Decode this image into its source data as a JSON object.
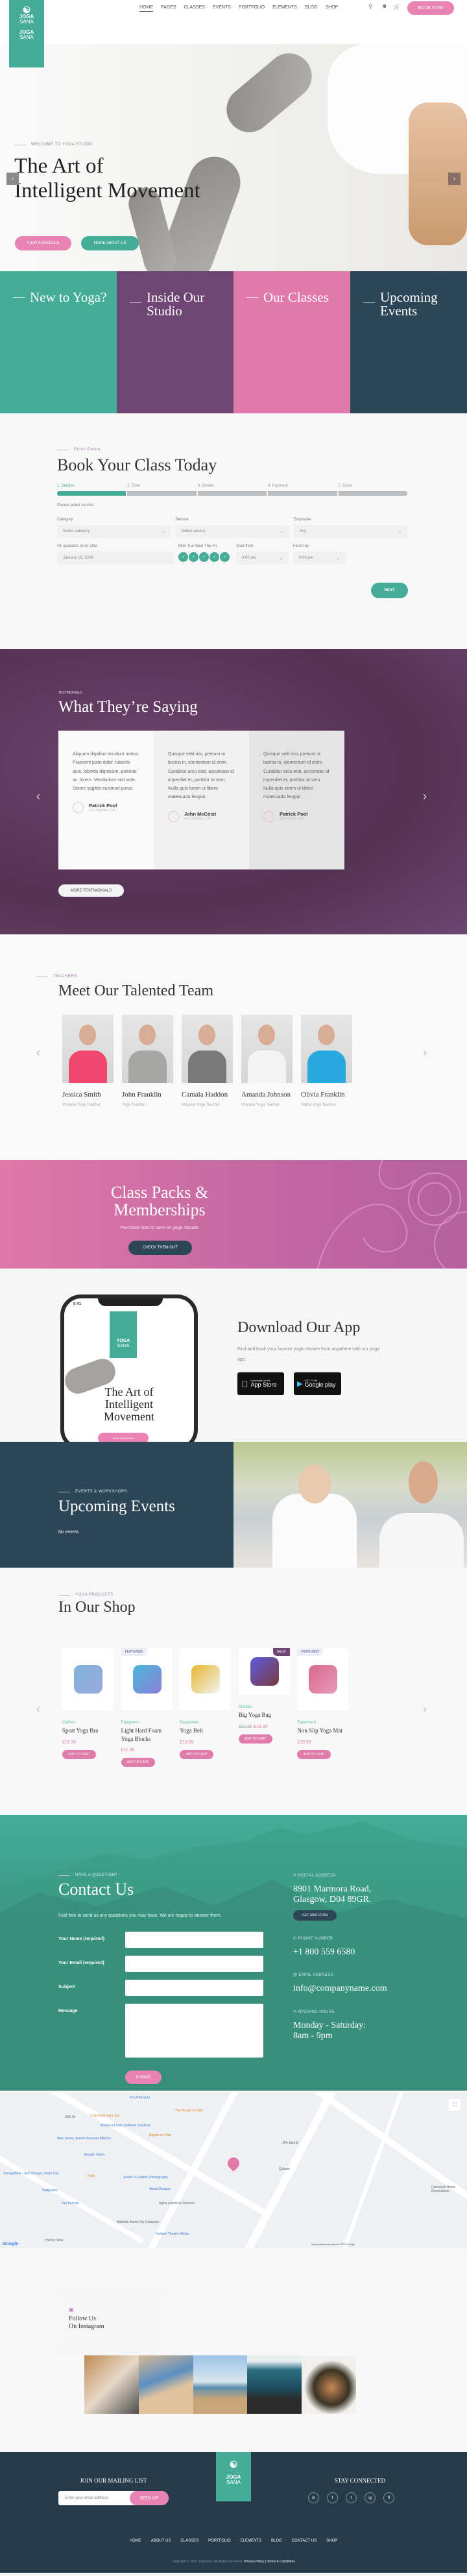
{
  "header": {
    "logo": {
      "line1": "JOGA",
      "line2": "SANA",
      "line3": "JOGA",
      "line4": "SANA"
    },
    "nav": [
      "HOME",
      "PAGES",
      "CLASSES",
      "EVENTS",
      "PORTFOLIO",
      "ELEMENTS",
      "BLOG",
      "SHOP"
    ],
    "active_nav": "HOME",
    "book_now": "BOOK NOW"
  },
  "hero": {
    "eyebrow": "WELCOME TO YOGA STUDIO",
    "title_line1": "The Art of",
    "title_line2": "Intelligent Movement",
    "btn_schedule": "VIEW SCHEDULE",
    "btn_about": "MORE ABOUT US"
  },
  "feature_boxes": [
    {
      "title": "New to Yoga?",
      "color": "#45ad97"
    },
    {
      "title": "Inside Our Studio",
      "color": "#6f4573"
    },
    {
      "title": "Our Classes",
      "color": "#e07aab"
    },
    {
      "title": "Upcoming Events",
      "color": "#2d4657"
    }
  ],
  "booking": {
    "eyebrow": "Enroll Online",
    "title": "Book Your Class Today",
    "steps": [
      "1. Service",
      "2. Time",
      "3. Details",
      "4. Payment",
      "5. Done"
    ],
    "active_step": 1,
    "prompt": "Please select service:",
    "category_label": "Category",
    "category_value": "Select category",
    "service_label": "Service",
    "service_value": "Select service",
    "employee_label": "Employee",
    "employee_value": "Any",
    "date_label": "I'm available on or after",
    "date_value": "January 19, 2024",
    "days": [
      "Mon",
      "Tue",
      "Wed",
      "Thu",
      "Fri"
    ],
    "start_label": "Start from",
    "start_value": "8:00 am",
    "finish_label": "Finish by",
    "finish_value": "6:00 pm",
    "next": "NEXT"
  },
  "testimonials": {
    "eyebrow": "TESTIMONIALS",
    "title": "What They’re Saying",
    "items": [
      {
        "text": "Aliquam dapibus tincidunt metus. Praesent justo dolor, lobortis quis, lobortis dignissim, pulvinar ac, lorem. Vestibulum sed ante. Donec sagittis euismod purus.",
        "name": "Patrick Pool",
        "place": "Los Angeles, CA"
      },
      {
        "text": "Quisque velit nisi, pretium ut lacinia in, elementum id enim. Curabitur arcu erat, accumsan id imperdiet et, porttitor at sem. Nulla quis lorem ut libero malesuada feugiat.",
        "name": "John McCoist",
        "place": "Los Angeles, CA"
      },
      {
        "text": "Quisque velit nisi, pretium ut lacinia in, elementum id enim. Curabitur arcu erat, accumsan id imperdiet et, porttitor at sem. Nulla quis lorem ut libero malesuada feugiat.",
        "name": "Patrick Pool",
        "place": "San Diego, CA"
      }
    ],
    "more": "MORE TESTIMONIALS"
  },
  "team": {
    "eyebrow": "TEACHERS",
    "title": "Meet Our Talented Team",
    "members": [
      {
        "name": "Jessica Smith",
        "role": "Vinyasa Yoga Teacher",
        "top": "#f0466f"
      },
      {
        "name": "John Franklin",
        "role": "Yoga Teacher",
        "top": "#a6a6a4"
      },
      {
        "name": "Camala Haddon",
        "role": "Vinyasa Yoga Teacher",
        "top": "#7a7a7a"
      },
      {
        "name": "Amanda Johnson",
        "role": "Vinyasa Yoga Teacher",
        "top": "#f4f4f4"
      },
      {
        "name": "Olivia Franklin",
        "role": "Hatha Yoga Teacher",
        "top": "#27a8de"
      }
    ]
  },
  "packs": {
    "title_line1": "Class Packs &",
    "title_line2": "Memberships",
    "subtitle": "Purchase now to save on yoga classes",
    "button": "CHECK THEM OUT"
  },
  "app": {
    "title": "Download Our App",
    "text": "Find and book your favorite yoga classes from anywhere with our yoga app.",
    "phone_time": "9:41",
    "phone_logo1": "YOGA",
    "phone_logo2": "SANA",
    "phone_title": "The Art of Intelligent Movement",
    "phone_button": "VIEW SCHEDULE",
    "appstore_small": "Download on the",
    "appstore_big": "App Store",
    "gplay_small": "GET IT ON",
    "gplay_big": "Google play"
  },
  "events": {
    "eyebrow": "EVENTS & WORKSHOPS",
    "title": "Upcoming Events",
    "empty": "No events"
  },
  "shop": {
    "eyebrow": "YOGA PRODUCTS",
    "title": "In Our Shop",
    "products": [
      {
        "category": "Clothes",
        "name": "Sport Yoga Bra",
        "price": "£11.00",
        "old_price": "",
        "badge": "",
        "button": "ADD TO CART"
      },
      {
        "category": "Equipment",
        "name": "Light Hard Foam Yoga Blocks",
        "price": "£11.35",
        "old_price": "",
        "badge": "FEATURED!",
        "button": "ADD TO CART"
      },
      {
        "category": "Equipment",
        "name": "Yoga Belt",
        "price": "£13.95",
        "old_price": "",
        "badge": "",
        "button": "ADD TO CART"
      },
      {
        "category": "Clothes",
        "name": "Big Yoga Bag",
        "price": "£18.00",
        "old_price": "£21.00",
        "badge": "SALE!",
        "button": "ADD TO CART"
      },
      {
        "category": "Equipment",
        "name": "Non Slip Yoga Mat",
        "price": "£19.95",
        "old_price": "",
        "badge": "FEATURED!",
        "button": "ADD TO CART"
      }
    ]
  },
  "contact": {
    "eyebrow": "HAVE A QUESTION?",
    "title": "Contact Us",
    "intro": "Feel free to send us any questions you may have. We are happy to answer them.",
    "fields": [
      "Your Name (required)",
      "Your Email (required)",
      "Subject",
      "Message"
    ],
    "submit": "SUBMIT",
    "postal_label": "POSTAL ADDRESS",
    "postal_value": "8901 Marmora Road, Glasgow, D04 89GR.",
    "direction": "GET DIRECTION",
    "phone_label": "PHONE NUMBER",
    "phone_value": "+1 800 559 6580",
    "email_label": "EMAIL ADDRESS",
    "email_value": "info@companyname.com",
    "hours_label": "OPENING HOURS",
    "hours_value": "Monday - Saturday: 8am - 9pm"
  },
  "map": {
    "labels": [
      "Pro Med Quip",
      "The Burger Temple",
      "Tutti Frutti Juice Bar",
      "Advanced Data Software Solutions",
      "New Jersey Jewish Business Alliance",
      "Bagels on Park",
      "Aquatic Gems",
      "Patio",
      "StorageBlue - Self Storage, Union City",
      "Walgreens",
      "Jun Bum An",
      "Sweet 16 Sixteen Photography",
      "About Designs",
      "Alpha Electrical Services",
      "Qukwin",
      "Bibliofile Books On Computer",
      "Hudson Theatre Works",
      "Harbor View",
      "Comstock Home Renovations",
      "JFK Blvd E",
      "35th St"
    ],
    "footer": "Картографические данные ©2024 Google"
  },
  "instagram": {
    "title_line1": "Follow Us",
    "title_line2": "On Instagram"
  },
  "footer": {
    "mailing_title": "JOIN OUR MAILING LIST",
    "email_placeholder": "Enter your email address",
    "signup": "SIGN UP",
    "logo1": "JOGA",
    "logo2": "SANA",
    "connected_title": "STAY CONNECTED",
    "social": [
      "in",
      "f",
      "t",
      "ig",
      "fl"
    ],
    "nav": [
      "HOME",
      "ABOUT US",
      "CLASSES",
      "PORTFOLIO",
      "ELEMENTS",
      "BLOG",
      "CONTACT US",
      "SHOP"
    ],
    "copyright": "Copyright © 2023 Jogasana. All Rights Reserved.",
    "privacy": "Privacy Policy",
    "terms": "Terms & Conditions"
  },
  "colors": {
    "teal": "#45ad97",
    "pink": "#e07ca9",
    "purple": "#6f4573",
    "navy": "#263b4a"
  }
}
